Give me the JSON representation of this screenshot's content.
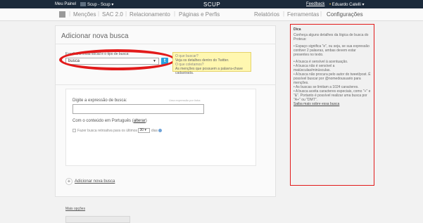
{
  "topbar": {
    "menu": "Meu Painel",
    "account": "Scup - Scup ▾",
    "logo": "SCUP",
    "feedback": "Feedback",
    "user_dot": "•",
    "user": "Eduardo Catelli ▾"
  },
  "nav": {
    "items": [
      "Menções",
      "SAC 2.0",
      "Relacionamento",
      "Páginas e Perfis"
    ],
    "right_items": [
      "Relatórios",
      "Ferramentas",
      "Configurações"
    ]
  },
  "main": {
    "title": "Adicionar nova busca",
    "network_label": "Escolha a mídia social e o tipo de busca:",
    "select_value": "busca",
    "select_caret": "▼",
    "twitter_glyph": "t",
    "tip": {
      "q1": "O que buscar?",
      "a1": "Veja os detalhes dentro do Twitter.",
      "q2": "O que coletamos?",
      "a2": "As menções que possuem a palavra-chave cadastrada."
    },
    "expr_label": "Digite a expressão de busca:",
    "expr_hint": "Uma expressão por linha",
    "pt_prefix": "Com o conteúdo em Português (",
    "pt_link": "alterar",
    "pt_suffix": ")",
    "days_text": "Fazer busca retroativa para os últimos",
    "days_value": "30 ▾",
    "days_suffix": "dias",
    "add_plus": "+",
    "add_label": "Adicionar nova busca",
    "more_label": "Mais opções"
  },
  "sidebar": {
    "heading": "Dica",
    "intro": "Conheça alguns detalhes da lógica de busca do Proteus:",
    "lines": [
      "• Espaço significa \"e\", ou seja, se sua expressão contiver 2 palavras, ambas devem estar presentes no texto.",
      "• A busca é sensível à acentuação.",
      "• A busca não é sensível a maiúsculas/minúsculas.",
      "• A busca não procura pelo autor do tweet/post. É possível buscar por @nomedousuario para menções.",
      "• As buscas se limitam a 1024 caracteres.",
      "• A busca aceita caracteres especiais, como \"+\" e \"&\". Portanto é possível realizar uma busca por \"A+\" ou \"DMT\"."
    ],
    "link": "Saiba mais sobre essa busca"
  }
}
